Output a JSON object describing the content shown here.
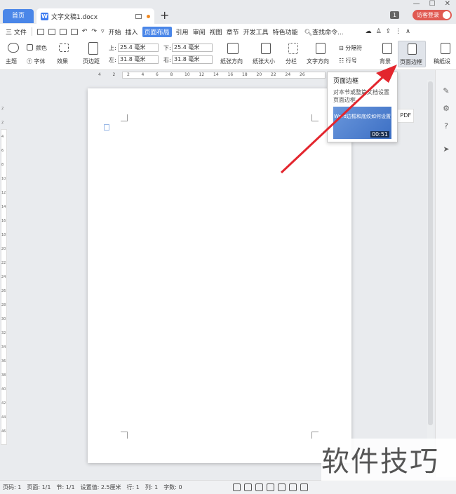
{
  "tabs": {
    "home_label": "首页",
    "doc_label": "文字文稿1.docx",
    "add_label": "+"
  },
  "window": {
    "minimize": "—",
    "maximize": "☐",
    "close": "✕",
    "count_badge": "1",
    "visitor_label": "访客登录"
  },
  "menubar": {
    "file_label": "三 文件",
    "tabs": [
      "开始",
      "插入",
      "页面布局",
      "引用",
      "审阅",
      "视图",
      "章节",
      "开发工具",
      "特色功能"
    ],
    "active_tab": "页面布局",
    "search_label": "查找命令..."
  },
  "ribbon": {
    "theme_label": "主题",
    "color_label": "颜色",
    "font_label": "字体",
    "effect_label": "效果",
    "margin_label": "页边距",
    "top_label": "上:",
    "top_value": "25.4 毫米",
    "bottom_label": "下:",
    "bottom_value": "25.4 毫米",
    "left_label": "左:",
    "left_value": "31.8 毫米",
    "right_label": "右:",
    "right_value": "31.8 毫米",
    "orientation_label": "纸张方向",
    "size_label": "纸张大小",
    "columns_label": "分栏",
    "text_direction_label": "文字方向",
    "break_label": "分隔符",
    "line_number_label": "行号",
    "background_label": "背景",
    "page_border_label": "页面边框",
    "draft_label": "稿纸设"
  },
  "ruler": {
    "ticks": [
      "4",
      "2",
      "2",
      "4",
      "6",
      "8",
      "10",
      "12",
      "14",
      "16",
      "18",
      "20",
      "22",
      "24",
      "26"
    ],
    "vticks": [
      "2",
      "2",
      "4",
      "6",
      "8",
      "10",
      "12",
      "14",
      "16",
      "18",
      "20",
      "22",
      "24",
      "26",
      "28",
      "30",
      "32",
      "34",
      "36",
      "38",
      "40",
      "42",
      "44",
      "46"
    ]
  },
  "tooltip": {
    "title": "页面边框",
    "description": "对本节或整篇文档设置页面边框。",
    "video_title": "Word边框和底纹如何设置",
    "video_time": "00:51"
  },
  "pdf_chip": "PDF",
  "statusbar": {
    "page_num": "页码: 1",
    "pages": "页面: 1/1",
    "section": "节: 1/1",
    "setting": "设置值: 2.5厘米",
    "row": "行: 1",
    "col": "列: 1",
    "word_count": "字数: 0"
  },
  "watermark_text": "软件技巧",
  "colors": {
    "accent": "#4a86e8",
    "arrow": "#e3262e",
    "visitor": "#e05a52"
  }
}
